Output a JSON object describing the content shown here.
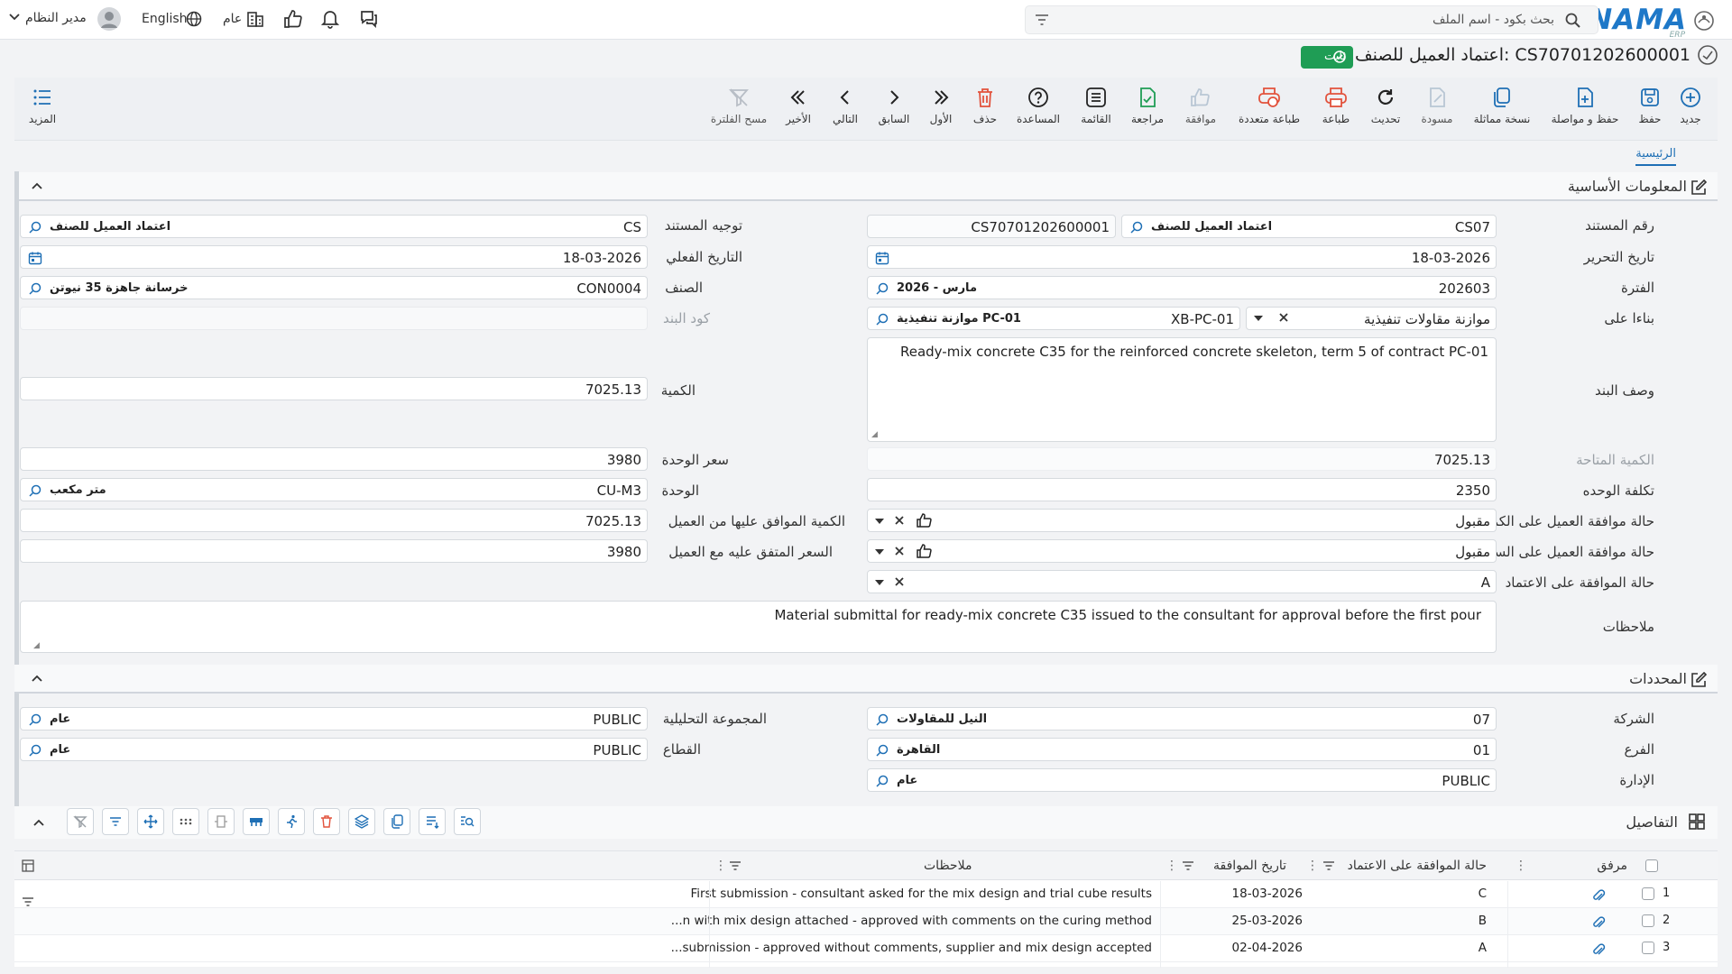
{
  "app": {
    "logo_text": "NAMA",
    "logo_sub": "ERP",
    "brand_color": "#1e78c8"
  },
  "topbar": {
    "search_placeholder": "بحث بكود - اسم الملف",
    "scope_label": "عام",
    "language_label": "English",
    "user_label": "مدير النظام"
  },
  "document": {
    "title": "اعتماد العميل للصنف: CS70701202600001",
    "status_badge": "ثابت",
    "status_color": "#1f9d55"
  },
  "toolbar": {
    "items": [
      {
        "key": "new",
        "label": "جديد",
        "icon": "plus-circle-icon"
      },
      {
        "key": "save",
        "label": "حفظ",
        "icon": "save-icon"
      },
      {
        "key": "save_continue",
        "label": "حفظ و مواصلة",
        "icon": "save-continue-icon"
      },
      {
        "key": "duplicate",
        "label": "نسخة مماثلة",
        "icon": "copy-icon"
      },
      {
        "key": "draft",
        "label": "مسودة",
        "icon": "draft-icon"
      },
      {
        "key": "refresh",
        "label": "تحديث",
        "icon": "refresh-icon"
      },
      {
        "key": "print",
        "label": "طباعة",
        "icon": "print-icon"
      },
      {
        "key": "multi_print",
        "label": "طباعة متعددة",
        "icon": "multi-print-icon"
      },
      {
        "key": "approve",
        "label": "موافقة",
        "icon": "thumbs-up-icon"
      },
      {
        "key": "review",
        "label": "مراجعة",
        "icon": "review-icon"
      },
      {
        "key": "list",
        "label": "القائمة",
        "icon": "list-icon"
      },
      {
        "key": "help",
        "label": "المساعدة",
        "icon": "help-icon"
      },
      {
        "key": "delete",
        "label": "حذف",
        "icon": "trash-icon"
      },
      {
        "key": "first",
        "label": "الأول",
        "icon": "first-icon"
      },
      {
        "key": "prev",
        "label": "السابق",
        "icon": "prev-icon"
      },
      {
        "key": "next",
        "label": "التالي",
        "icon": "next-icon"
      },
      {
        "key": "last",
        "label": "الأخير",
        "icon": "last-icon"
      },
      {
        "key": "clear_filter",
        "label": "مسح الفلترة",
        "icon": "clear-filter-icon"
      }
    ],
    "more_label": "المزيد"
  },
  "tabs": {
    "main": "الرئيسية"
  },
  "basic": {
    "section_title": "المعلومات الأساسية",
    "doc_number_label": "رقم المستند",
    "doc_type_code": "CS07",
    "doc_type_name": "اعتماد العميل للصنف",
    "doc_number": "CS70701202600001",
    "direction_label": "توجيه المستند",
    "direction_code": "CS",
    "direction_name": "اعتماد العميل للصنف",
    "edit_date_label": "تاريخ التحرير",
    "edit_date": "18-03-2026",
    "actual_date_label": "التاريخ الفعلي",
    "actual_date": "18-03-2026",
    "period_label": "الفترة",
    "period_code": "202603",
    "period_name": "مارس - 2026",
    "item_label": "الصنف",
    "item_code": "CON0004",
    "item_name": "خرسانة جاهزة 35 نيوتن",
    "based_on_label": "بناءا على",
    "based_on_type": "موازنة مقاولات تنفيذية",
    "based_on_code": "XB-PC-01",
    "based_on_name": "موازنة تنفيذية PC-01",
    "line_code_label": "كود البند",
    "line_code": "",
    "line_desc_label": "وصف البند",
    "line_desc": "Ready-mix concrete C35 for the reinforced concrete skeleton, term 5 of contract PC-01",
    "qty_label": "الكمية",
    "qty": "7025.13",
    "avail_qty_label": "الكمية المتاحة",
    "avail_qty": "7025.13",
    "unit_price_label": "سعر الوحدة",
    "unit_price": "3980",
    "unit_cost_label": "تكلفة الوحده",
    "unit_cost": "2350",
    "unit_label": "الوحدة",
    "unit_code": "CU-M3",
    "unit_name": "متر مكعب",
    "client_qty_status_label": "حالة موافقة العميل على الكمية",
    "client_qty_status": "مقبول",
    "client_qty_label": "الكمية الموافق عليها من العميل",
    "client_qty": "7025.13",
    "client_price_status_label": "حالة موافقة العميل على السعر",
    "client_price_status": "مقبول",
    "client_price_label": "السعر المتفق عليه مع العميل",
    "client_price": "3980",
    "approval_status_label": "حالة الموافقة على الاعتماد",
    "approval_status": "A",
    "notes_label": "ملاحظات",
    "notes": "Material submittal for ready-mix concrete C35 issued to the consultant for approval before the first pour"
  },
  "dims": {
    "section_title": "المحددات",
    "company_label": "الشركة",
    "company_code": "07",
    "company_name": "النيل للمقاولات",
    "analytic_label": "المجموعة التحليلية",
    "analytic_code": "PUBLIC",
    "analytic_name": "عام",
    "branch_label": "الفرع",
    "branch_code": "01",
    "branch_name": "القاهرة",
    "sector_label": "القطاع",
    "sector_code": "PUBLIC",
    "sector_name": "عام",
    "dept_label": "الإدارة",
    "dept_code": "PUBLIC",
    "dept_name": "عام"
  },
  "details": {
    "section_title": "التفاصيل",
    "columns": {
      "attachment": "مرفق",
      "approval_status": "حالة الموافقة على الاعتماد",
      "approval_date": "تاريخ الموافقة",
      "notes": "ملاحظات"
    },
    "rows": [
      {
        "n": "1",
        "status": "C",
        "date": "18-03-2026",
        "notes": "First submission - consultant asked for the mix design and trial cube results"
      },
      {
        "n": "2",
        "status": "B",
        "date": "25-03-2026",
        "notes": "...n with mix design attached - approved with comments on the curing method"
      },
      {
        "n": "3",
        "status": "A",
        "date": "02-04-2026",
        "notes": "...submission - approved without comments, supplier and mix design accepted"
      }
    ]
  }
}
